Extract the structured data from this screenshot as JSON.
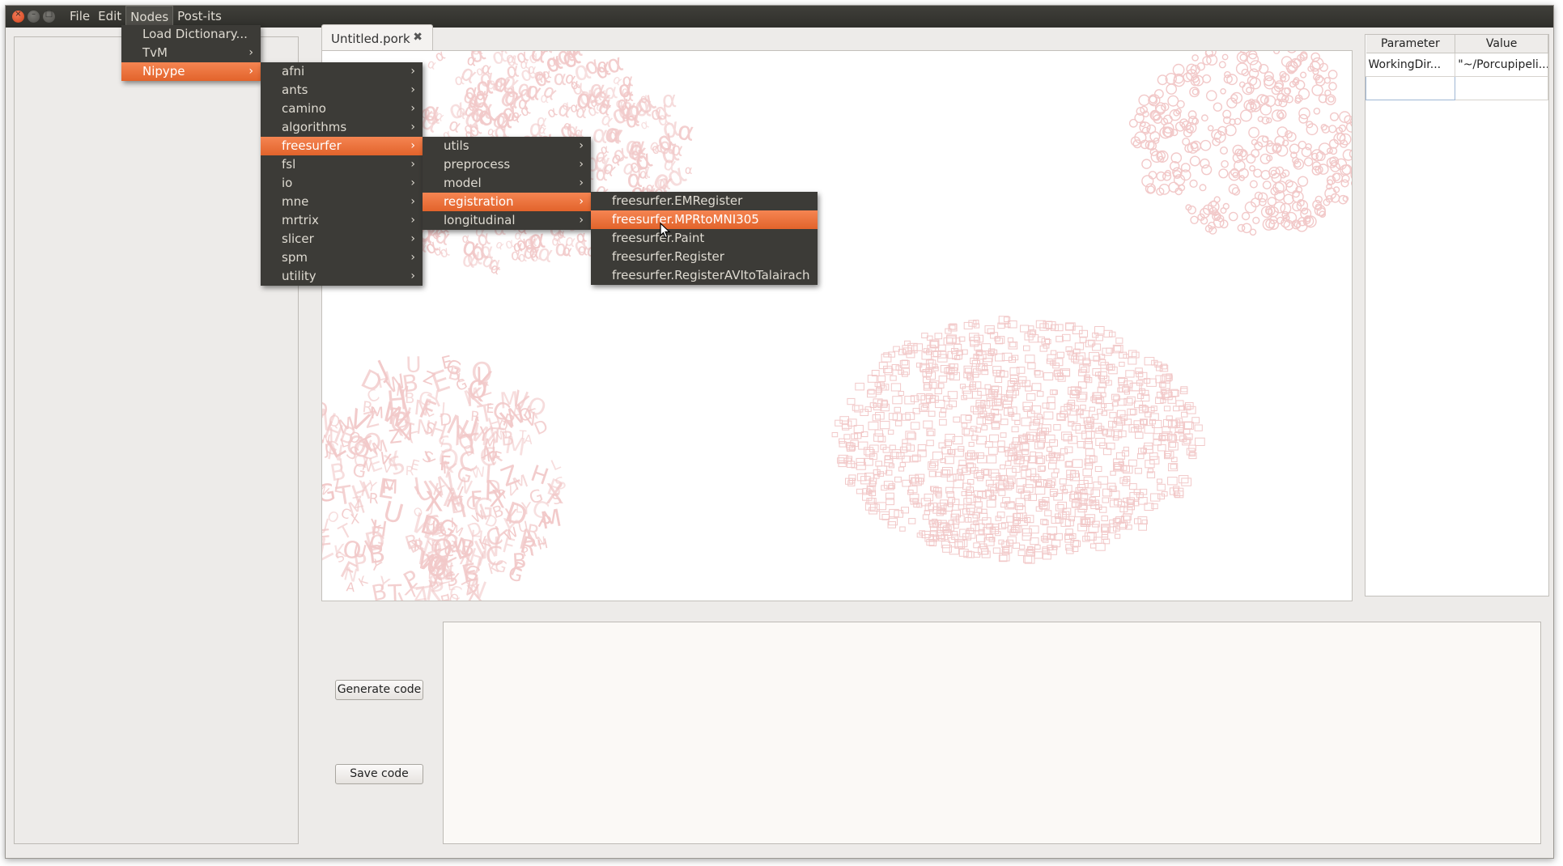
{
  "window": {
    "controls": [
      "×",
      "–",
      "□"
    ],
    "menubar": [
      "File",
      "Edit",
      "Nodes",
      "Post-its"
    ]
  },
  "tab": {
    "label": "Untitled.pork",
    "close_glyph": "✖"
  },
  "properties": {
    "headers": [
      "Parameter",
      "Value"
    ],
    "rows": [
      {
        "param": "WorkingDir...",
        "value": "\"~/Porcupipeli..."
      },
      {
        "param": "",
        "value": ""
      }
    ]
  },
  "buttons": {
    "generate": "Generate code",
    "save": "Save code"
  },
  "menus": {
    "nodes": [
      {
        "label": "Load Dictionary...",
        "sub": false
      },
      {
        "label": "TvM",
        "sub": true
      },
      {
        "label": "Nipype",
        "sub": true,
        "selected": true
      }
    ],
    "nipype": [
      {
        "label": "afni",
        "sub": true
      },
      {
        "label": "ants",
        "sub": true
      },
      {
        "label": "camino",
        "sub": true
      },
      {
        "label": "algorithms",
        "sub": true
      },
      {
        "label": "freesurfer",
        "sub": true,
        "selected": true
      },
      {
        "label": "fsl",
        "sub": true
      },
      {
        "label": "io",
        "sub": true
      },
      {
        "label": "mne",
        "sub": true
      },
      {
        "label": "mrtrix",
        "sub": true
      },
      {
        "label": "slicer",
        "sub": true
      },
      {
        "label": "spm",
        "sub": true
      },
      {
        "label": "utility",
        "sub": true
      }
    ],
    "freesurfer": [
      {
        "label": "utils",
        "sub": true
      },
      {
        "label": "preprocess",
        "sub": true
      },
      {
        "label": "model",
        "sub": true
      },
      {
        "label": "registration",
        "sub": true,
        "selected": true
      },
      {
        "label": "longitudinal",
        "sub": true
      }
    ],
    "registration": [
      {
        "label": "freesurfer.EMRegister",
        "sub": false
      },
      {
        "label": "freesurfer.MPRtoMNI305",
        "sub": false,
        "selected": true
      },
      {
        "label": "freesurfer.Paint",
        "sub": false
      },
      {
        "label": "freesurfer.Register",
        "sub": false
      },
      {
        "label": "freesurfer.RegisterAVItoTalairach",
        "sub": false
      }
    ]
  },
  "decor": {
    "letters": "ABCDEFGHIJKLMNOPQRSTUVWXYZ",
    "colors": {
      "accent": "#e5652d",
      "menu_bg": "#3c3b37",
      "watermark": "#f2c9c9"
    }
  }
}
